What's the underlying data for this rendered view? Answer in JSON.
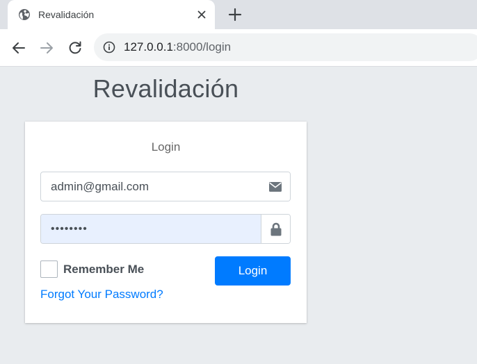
{
  "browser": {
    "tab_title": "Revalidación",
    "url_host": "127.0.0.1",
    "url_rest": ":8000/login",
    "icons": {
      "favicon": "globe-icon",
      "close": "close-icon",
      "new_tab": "plus-icon",
      "back": "arrow-left-icon",
      "forward": "arrow-right-icon",
      "reload": "reload-icon",
      "site_info": "info-icon"
    }
  },
  "page": {
    "brand": "Revalidación",
    "card_message": "Login",
    "email": {
      "value": "admin@gmail.com",
      "icon": "envelope-icon"
    },
    "password": {
      "value": "••••••••",
      "icon": "lock-icon"
    },
    "remember_label": "Remember Me",
    "login_button": "Login",
    "forgot_link": "Forgot Your Password?"
  },
  "colors": {
    "primary": "#007bff",
    "page_bg": "#e9ecef",
    "autofill_bg": "#e8f0fe"
  }
}
